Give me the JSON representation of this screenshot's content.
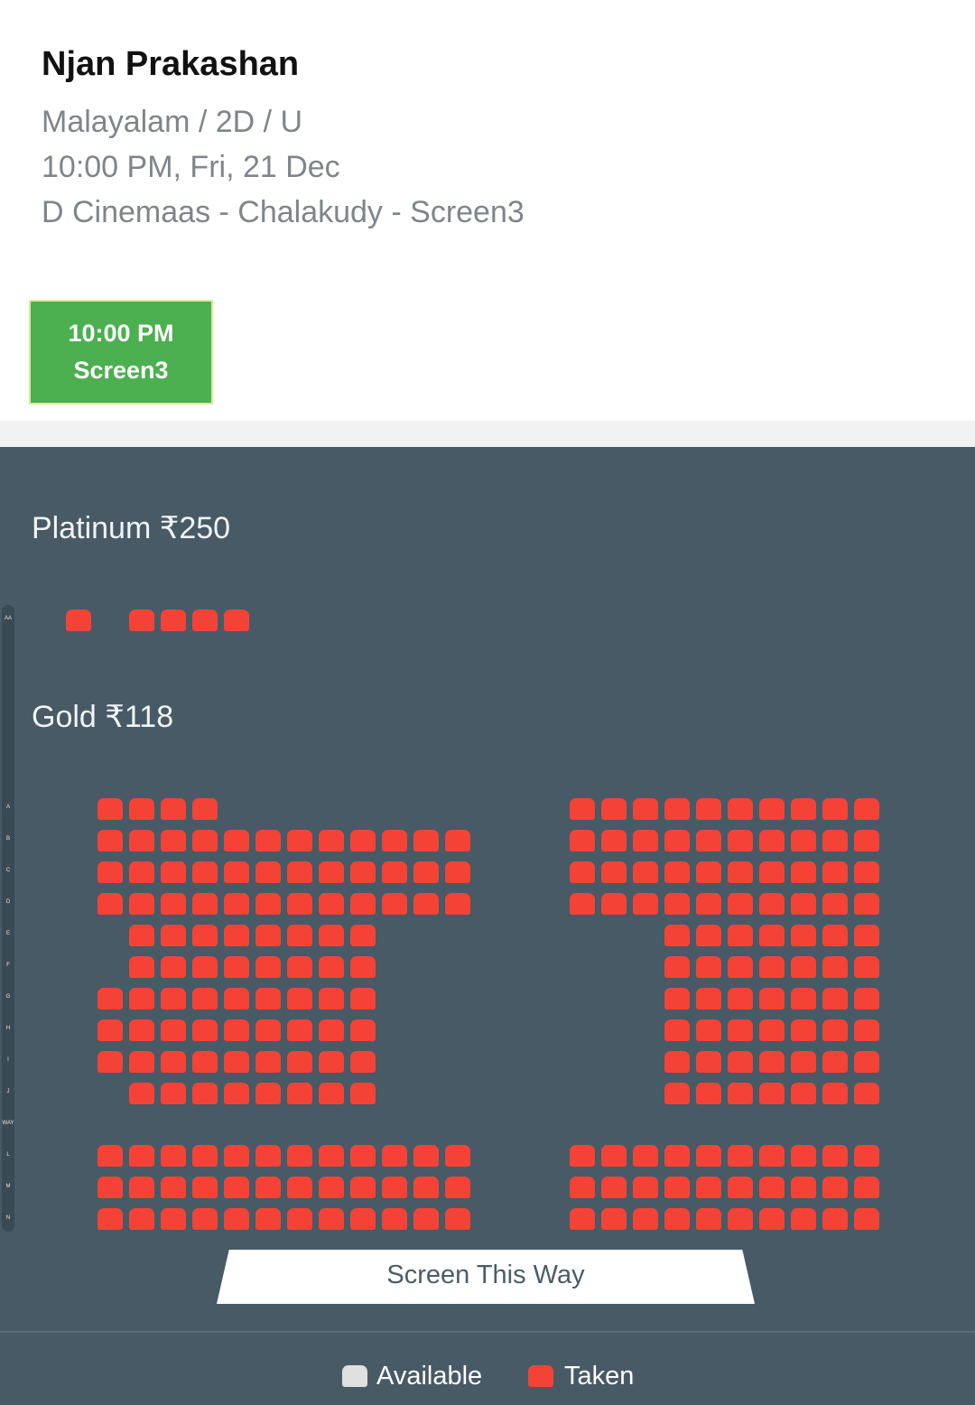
{
  "header": {
    "title": "Njan Prakashan",
    "meta_line1": "Malayalam / 2D / U",
    "meta_line2": "10:00 PM, Fri, 21 Dec",
    "meta_line3": "D Cinemaas - Chalakudy - Screen3",
    "showtime": {
      "time": "10:00 PM",
      "screen": "Screen3"
    }
  },
  "seatmap": {
    "sections": [
      {
        "label": "Platinum ₹250"
      },
      {
        "label": "Gold ₹118"
      }
    ],
    "row_labels": [
      "AA",
      "A",
      "B",
      "C",
      "D",
      "E",
      "F",
      "G",
      "H",
      "I",
      "J",
      "WAY",
      "L",
      "M",
      "N"
    ],
    "screen_label": "Screen This Way"
  },
  "legend": {
    "available": "Available",
    "taken": "Taken"
  },
  "colors": {
    "taken": "#f44336",
    "available": "#e0e0e0",
    "seatmap_bg": "#475a66",
    "show_button": "#4caf50"
  }
}
